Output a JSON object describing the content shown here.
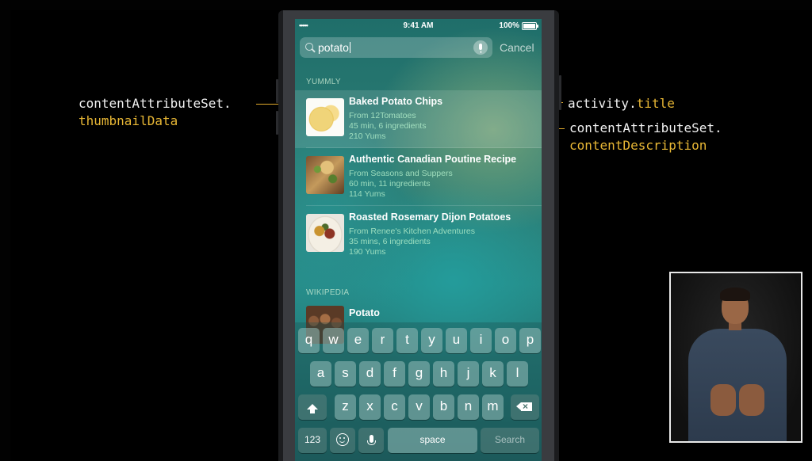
{
  "annotations": {
    "thumbnail": {
      "line1": "contentAttributeSet.",
      "line2": "thumbnailData"
    },
    "activity_title": {
      "prefix": "activity.",
      "suffix": "title"
    },
    "content_description": {
      "line1": "contentAttributeSet.",
      "line2": "contentDescription"
    }
  },
  "status_bar": {
    "signal": "•••••",
    "time": "9:41 AM",
    "battery": "100%"
  },
  "search": {
    "query": "potato",
    "cancel_label": "Cancel"
  },
  "sections": [
    {
      "header": "YUMMLY",
      "results": [
        {
          "title": "Baked Potato Chips",
          "source": "From 12Tomatoes",
          "details": "45 min, 6 ingredients",
          "yums": "210 Yums"
        },
        {
          "title": "Authentic Canadian Poutine Recipe",
          "source": "From Seasons and Suppers",
          "details": "60 min, 11 ingredients",
          "yums": "114 Yums"
        },
        {
          "title": "Roasted Rosemary Dijon Potatoes",
          "source": "From Renee's Kitchen Adventures",
          "details": "35 mins, 6 ingredients",
          "yums": "190 Yums"
        }
      ]
    },
    {
      "header": "WIKIPEDIA",
      "results": [
        {
          "title": "Potato"
        }
      ]
    }
  ],
  "keyboard": {
    "row1": [
      "q",
      "w",
      "e",
      "r",
      "t",
      "y",
      "u",
      "i",
      "o",
      "p"
    ],
    "row2": [
      "a",
      "s",
      "d",
      "f",
      "g",
      "h",
      "j",
      "k",
      "l"
    ],
    "row3": [
      "z",
      "x",
      "c",
      "v",
      "b",
      "n",
      "m"
    ],
    "numbers_label": "123",
    "space_label": "space",
    "search_label": "Search"
  },
  "colors": {
    "annotation_accent": "#e8b735",
    "annotation_text": "#f2f2f2"
  }
}
